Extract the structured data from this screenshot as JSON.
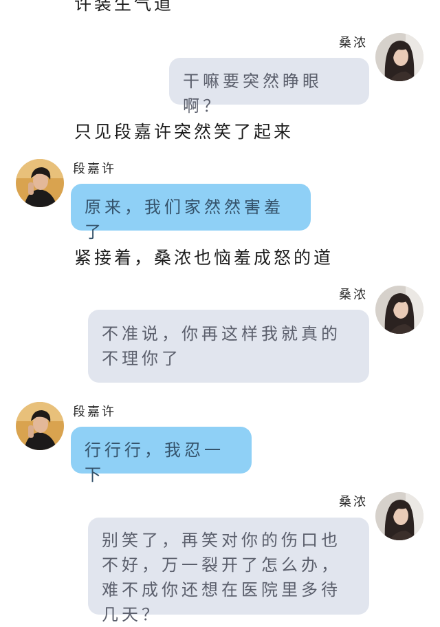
{
  "chat": {
    "narrations": {
      "top_partial": "许装生气道",
      "n1": "只见段嘉许突然笑了起来",
      "n2": "紧接着，桑浓也恼羞成怒的道"
    },
    "female_name": "桑浓",
    "male_name": "段嘉许",
    "messages": {
      "m1": "干嘛要突然睁眼啊？",
      "m2": "原来，我们家然然害羞了",
      "m3": "不准说，你再这样我就真的不理你了",
      "m4": "行行行，我忍一下",
      "m5": "别笑了，再笑对你的伤口也不好，万一裂开了怎么办，难不成你还想在医院里多待几天？"
    }
  },
  "colors": {
    "gray_bubble": "#e1e5ee",
    "blue_bubble": "#8fd0f6"
  }
}
